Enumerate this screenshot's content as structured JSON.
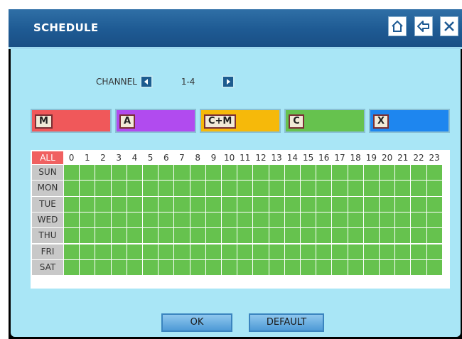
{
  "window": {
    "title": "SCHEDULE"
  },
  "titlebar_buttons": [
    {
      "name": "home-icon"
    },
    {
      "name": "back-icon"
    },
    {
      "name": "close-icon"
    }
  ],
  "channel": {
    "label": "CHANNEL",
    "value": "1-4"
  },
  "modes": [
    {
      "tag": "M",
      "color": "#f0585a"
    },
    {
      "tag": "A",
      "color": "#b14bef"
    },
    {
      "tag": "C+M",
      "color": "#f6b90a"
    },
    {
      "tag": "C",
      "color": "#66c24e"
    },
    {
      "tag": "X",
      "color": "#1e86ef"
    }
  ],
  "schedule": {
    "all_label": "ALL",
    "hours": [
      "0",
      "1",
      "2",
      "3",
      "4",
      "5",
      "6",
      "7",
      "8",
      "9",
      "10",
      "11",
      "12",
      "13",
      "14",
      "15",
      "16",
      "17",
      "18",
      "19",
      "20",
      "21",
      "22",
      "23"
    ],
    "days": [
      "SUN",
      "MON",
      "TUE",
      "WED",
      "THU",
      "FRI",
      "SAT"
    ],
    "slot_mode": "C",
    "slot_color": "#66c24e"
  },
  "buttons": {
    "ok": "OK",
    "default": "DEFAULT"
  }
}
